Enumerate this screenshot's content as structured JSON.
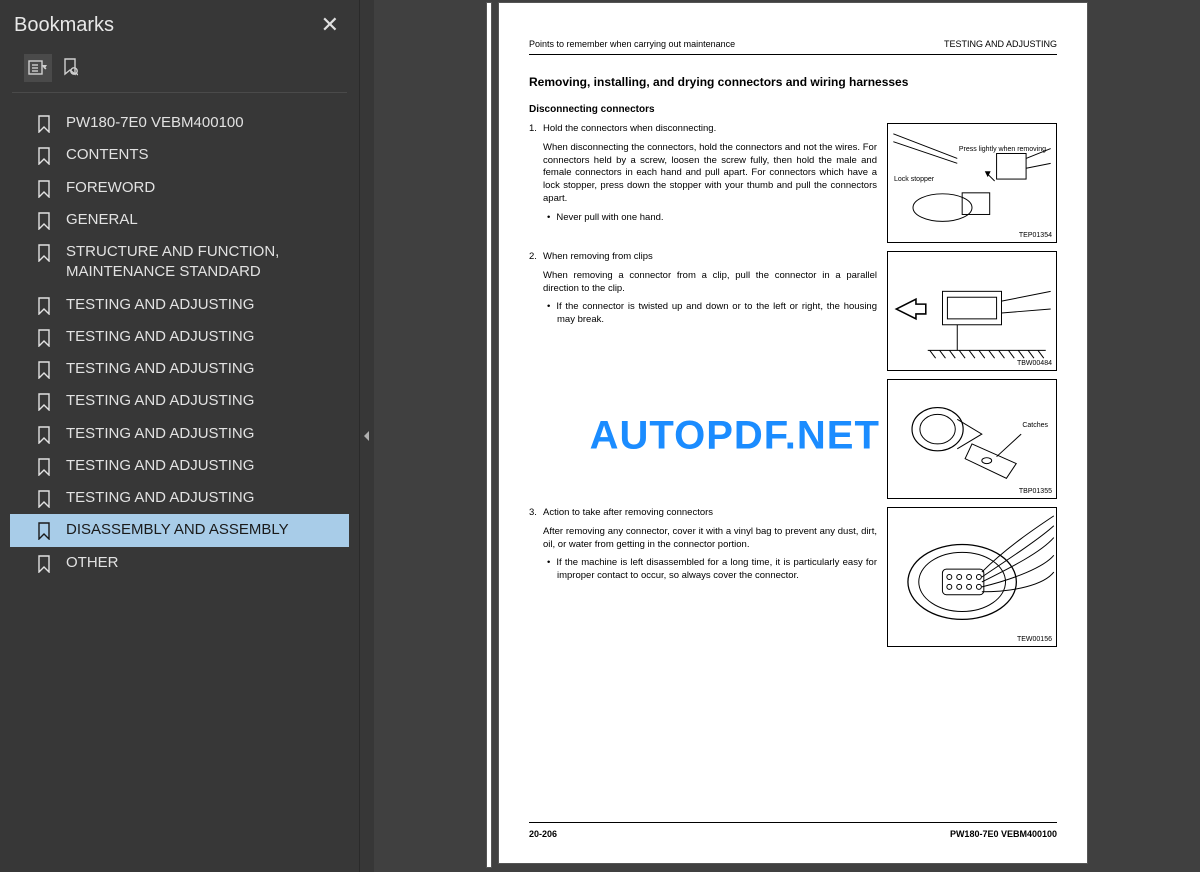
{
  "sidebar": {
    "title": "Bookmarks",
    "items": [
      {
        "label": "PW180-7E0    VEBM400100",
        "selected": false
      },
      {
        "label": "CONTENTS",
        "selected": false
      },
      {
        "label": "FOREWORD",
        "selected": false
      },
      {
        "label": "GENERAL",
        "selected": false
      },
      {
        "label": "STRUCTURE AND FUNCTION, MAINTENANCE STANDARD",
        "selected": false
      },
      {
        "label": "TESTING AND ADJUSTING",
        "selected": false
      },
      {
        "label": "TESTING AND ADJUSTING",
        "selected": false
      },
      {
        "label": "TESTING AND ADJUSTING",
        "selected": false
      },
      {
        "label": "TESTING AND ADJUSTING",
        "selected": false
      },
      {
        "label": "TESTING AND ADJUSTING",
        "selected": false
      },
      {
        "label": "TESTING AND ADJUSTING",
        "selected": false
      },
      {
        "label": "TESTING AND ADJUSTING",
        "selected": false
      },
      {
        "label": "DISASSEMBLY AND ASSEMBLY",
        "selected": true
      },
      {
        "label": "OTHER",
        "selected": false
      }
    ]
  },
  "watermark": "AUTOPDF.NET",
  "page": {
    "header_left": "Points to remember when carrying out maintenance",
    "header_right": "TESTING AND ADJUSTING",
    "title": "Removing, installing, and drying connectors and wiring harnesses",
    "subtitle": "Disconnecting connectors",
    "sections": [
      {
        "num": "1.",
        "lead": "Hold the connectors when disconnecting.",
        "body": "When disconnecting the connectors, hold the connectors and not the wires. For connectors held by a screw, loosen the screw fully, then hold the male and female connectors in each hand and pull apart. For connectors which have a lock stopper, press down the stopper with your thumb and pull the connectors apart.",
        "bullet": "Never pull with one hand.",
        "fig_id": "TEP01354",
        "fig_label_a": "Press lightly when removing",
        "fig_label_b": "Lock stopper"
      },
      {
        "num": "2.",
        "lead": "When removing from clips",
        "body": "When removing a connector from a clip, pull the connector in a parallel direction to the clip.",
        "bullet": "If the connector is twisted up and down or to the left or right, the housing may break.",
        "fig_id": "TBW00484"
      },
      {
        "num": "",
        "lead": "",
        "body": "",
        "bullet": "",
        "fig_id": "TBP01355",
        "fig_label_a": "Catches"
      },
      {
        "num": "3.",
        "lead": "Action to take after removing connectors",
        "body": "After removing any connector, cover it with a vinyl bag to prevent any dust, dirt, oil, or water from getting in the connector portion.",
        "bullet": "If the machine is left disassembled for a long time, it is particularly easy for improper contact to occur, so always cover the connector.",
        "fig_id": "TEW00156"
      }
    ],
    "footer_left": "20-206",
    "footer_right": "PW180-7E0    VEBM400100"
  }
}
